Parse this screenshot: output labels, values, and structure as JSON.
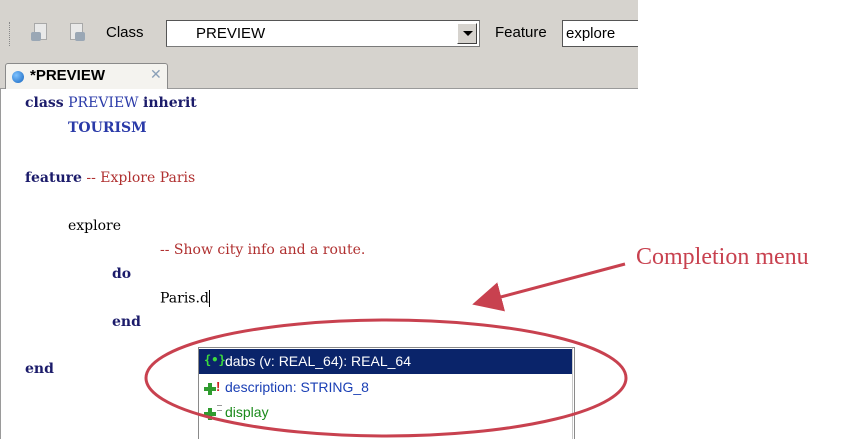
{
  "toolbar": {
    "class_label": "Class",
    "class_value": "PREVIEW",
    "feature_label": "Feature",
    "feature_value": "explore"
  },
  "tab": {
    "title": "*PREVIEW",
    "close_glyph": "✕"
  },
  "code": {
    "line1_kw1": "class",
    "line1_name": "PREVIEW",
    "line1_kw2": "inherit",
    "line2": "TOURISM",
    "line3_kw": "feature",
    "line3_comment": "-- Explore Paris",
    "line4": "explore",
    "line5_comment": "-- Show city info and a route.",
    "line6_kw": "do",
    "line7": "Paris.d",
    "line8_kw": "end",
    "line9_kw": "end"
  },
  "completion": {
    "items": [
      {
        "label": "dabs (v: REAL_64): REAL_64",
        "icon": "routine-icon",
        "selected": true
      },
      {
        "label": "description: STRING_8",
        "icon": "attribute-icon",
        "selected": false
      },
      {
        "label": "display",
        "icon": "procedure-icon",
        "selected": false
      }
    ]
  },
  "annotation": {
    "label": "Completion menu",
    "color": "#c8414f"
  }
}
